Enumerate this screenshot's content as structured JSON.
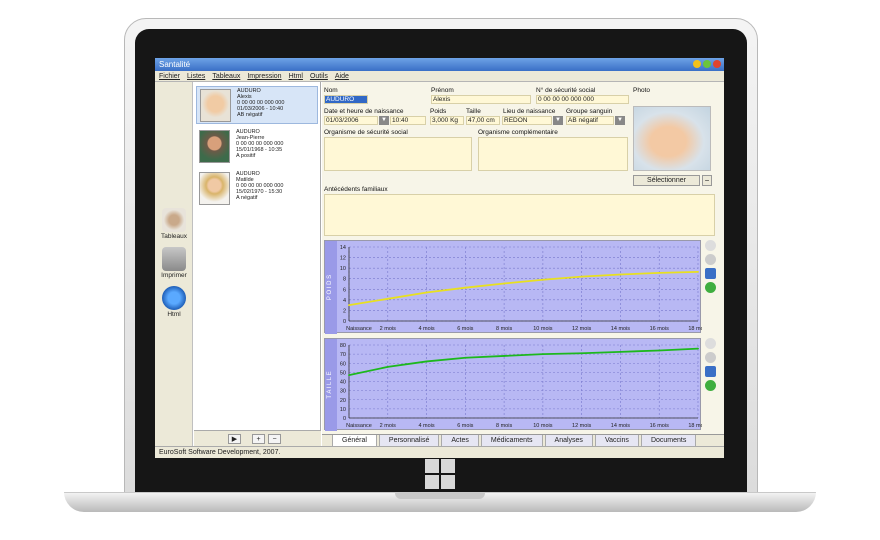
{
  "app": {
    "title": "Santalité",
    "menu": [
      "Fichier",
      "Listes",
      "Tableaux",
      "Impression",
      "Html",
      "Outils",
      "Aide"
    ],
    "tools": [
      {
        "label": "Tableaux",
        "icon": "eye-icon"
      },
      {
        "label": "Imprimer",
        "icon": "printer-icon"
      },
      {
        "label": "Html",
        "icon": "globe-icon"
      }
    ],
    "status": "EuroSoft Software Development, 2007."
  },
  "patients": [
    {
      "lines": [
        "AUDURO",
        "Alexis",
        "0 00 00 00 000 000",
        "01/03/2006 - 10:40",
        "AB négatif"
      ]
    },
    {
      "lines": [
        "AUDURO",
        "Jean-Pierre",
        "0 00 00 00 000 000",
        "15/01/1968 - 10:35",
        "A positif"
      ]
    },
    {
      "lines": [
        "AUDURO",
        "Matilde",
        "0 00 00 00 000 000",
        "15/02/1970 - 15:30",
        "A négatif"
      ]
    }
  ],
  "form": {
    "nom_label": "Nom",
    "nom": "AUDURO",
    "prenom_label": "Prénom",
    "prenom": "Alexis",
    "secu_label": "N° de sécurité social",
    "secu": "0 00 00 00 000 000",
    "photo_label": "Photo",
    "date_label": "Date et heure de naissance",
    "date": "01/03/2006",
    "heure": "10:40",
    "poids_label": "Poids",
    "poids": "3,000 Kg",
    "taille_label": "Taille",
    "taille": "47,00 cm",
    "lieu_label": "Lieu de naissance",
    "lieu": "REDON",
    "groupe_label": "Groupe sanguin",
    "groupe": "AB négatif",
    "org_secu_label": "Organisme de sécurité social",
    "org_comp_label": "Organisme complémentaire",
    "antecedents_label": "Antécédents familiaux",
    "select_button": "Sélectionner",
    "minus_button": "−"
  },
  "charts": {
    "x_labels": [
      "Naissance",
      "2 mois",
      "4 mois",
      "6 mois",
      "8 mois",
      "10 mois",
      "12 mois",
      "14 mois",
      "16 mois",
      "18 mois"
    ],
    "poids": {
      "side_label": "P O I D S",
      "y_ticks": [
        0,
        2,
        4,
        6,
        8,
        10,
        12,
        14
      ],
      "ymax": 14,
      "color": "#e8e020"
    },
    "taille": {
      "side_label": "T A I L L E",
      "y_ticks": [
        0,
        10,
        20,
        30,
        40,
        50,
        60,
        70,
        80
      ],
      "ymax": 80,
      "color": "#1db81d"
    }
  },
  "chart_data": [
    {
      "type": "line",
      "title": "",
      "ylabel": "POIDS",
      "ylim": [
        0,
        14
      ],
      "categories": [
        "Naissance",
        "2 mois",
        "4 mois",
        "6 mois",
        "8 mois",
        "10 mois",
        "12 mois",
        "14 mois",
        "16 mois",
        "18 mois"
      ],
      "values": [
        3.0,
        4.2,
        5.4,
        6.3,
        7.1,
        7.8,
        8.4,
        8.8,
        9.1,
        9.3
      ]
    },
    {
      "type": "line",
      "title": "",
      "ylabel": "TAILLE",
      "ylim": [
        0,
        80
      ],
      "categories": [
        "Naissance",
        "2 mois",
        "4 mois",
        "6 mois",
        "8 mois",
        "10 mois",
        "12 mois",
        "14 mois",
        "16 mois",
        "18 mois"
      ],
      "values": [
        47,
        56,
        62,
        66,
        68,
        70,
        71,
        72.5,
        74,
        76
      ]
    }
  ],
  "tabs": [
    "Général",
    "Personnalisé",
    "Actes",
    "Médicaments",
    "Analyses",
    "Vaccins",
    "Documents"
  ]
}
